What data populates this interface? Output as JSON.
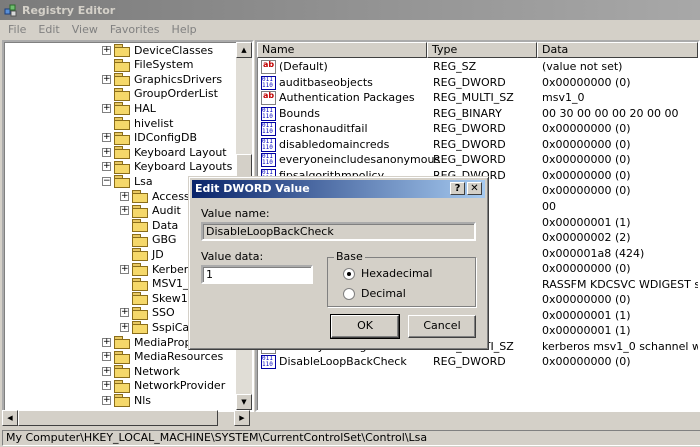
{
  "window": {
    "title": "Registry Editor",
    "icon": "registry-cubes-icon"
  },
  "menu": [
    "File",
    "Edit",
    "View",
    "Favorites",
    "Help"
  ],
  "tree": [
    {
      "label": "DeviceClasses",
      "expandable": true,
      "indent": 0
    },
    {
      "label": "FileSystem",
      "expandable": false,
      "indent": 0
    },
    {
      "label": "GraphicsDrivers",
      "expandable": true,
      "indent": 0
    },
    {
      "label": "GroupOrderList",
      "expandable": false,
      "indent": 0
    },
    {
      "label": "HAL",
      "expandable": true,
      "indent": 0
    },
    {
      "label": "hivelist",
      "expandable": false,
      "indent": 0
    },
    {
      "label": "IDConfigDB",
      "expandable": true,
      "indent": 0
    },
    {
      "label": "Keyboard Layout",
      "expandable": true,
      "indent": 0
    },
    {
      "label": "Keyboard Layouts",
      "expandable": true,
      "indent": 0
    },
    {
      "label": "Lsa",
      "expandable": true,
      "expanded": true,
      "indent": 0
    },
    {
      "label": "AccessPro",
      "expandable": true,
      "indent": 1
    },
    {
      "label": "Audit",
      "expandable": true,
      "indent": 1
    },
    {
      "label": "Data",
      "expandable": false,
      "indent": 1
    },
    {
      "label": "GBG",
      "expandable": false,
      "indent": 1
    },
    {
      "label": "JD",
      "expandable": false,
      "indent": 1
    },
    {
      "label": "Kerberos",
      "expandable": true,
      "indent": 1
    },
    {
      "label": "MSV1_0",
      "expandable": false,
      "indent": 1
    },
    {
      "label": "Skew1",
      "expandable": false,
      "indent": 1
    },
    {
      "label": "SSO",
      "expandable": true,
      "indent": 1
    },
    {
      "label": "SspiCache",
      "expandable": true,
      "indent": 1
    },
    {
      "label": "MediaProperties",
      "expandable": true,
      "indent": 0
    },
    {
      "label": "MediaResources",
      "expandable": true,
      "indent": 0
    },
    {
      "label": "Network",
      "expandable": true,
      "indent": 0
    },
    {
      "label": "NetworkProvider",
      "expandable": true,
      "indent": 0
    },
    {
      "label": "Nls",
      "expandable": true,
      "indent": 0
    }
  ],
  "columns": {
    "name": "Name",
    "type": "Type",
    "data": "Data"
  },
  "values": [
    {
      "icon": "string",
      "name": "(Default)",
      "type": "REG_SZ",
      "data": "(value not set)"
    },
    {
      "icon": "binary",
      "name": "auditbaseobjects",
      "type": "REG_DWORD",
      "data": "0x00000000 (0)"
    },
    {
      "icon": "string",
      "name": "Authentication Packages",
      "type": "REG_MULTI_SZ",
      "data": "msv1_0"
    },
    {
      "icon": "binary",
      "name": "Bounds",
      "type": "REG_BINARY",
      "data": "00 30 00 00 00 20 00 00"
    },
    {
      "icon": "binary",
      "name": "crashonauditfail",
      "type": "REG_DWORD",
      "data": "0x00000000 (0)"
    },
    {
      "icon": "binary",
      "name": "disabledomaincreds",
      "type": "REG_DWORD",
      "data": "0x00000000 (0)"
    },
    {
      "icon": "binary",
      "name": "everyoneincludesanonymous",
      "type": "REG_DWORD",
      "data": "0x00000000 (0)"
    },
    {
      "icon": "binary",
      "name": "fipsalgorithmpolicy",
      "type": "REG_DWORD",
      "data": "0x00000000 (0)"
    },
    {
      "icon": "binary",
      "name": "",
      "type": "",
      "data": "0x00000000 (0)"
    },
    {
      "icon": "binary",
      "name": "",
      "type": "",
      "data": "00"
    },
    {
      "icon": "binary",
      "name": "",
      "type": "D",
      "data": "0x00000001 (1)"
    },
    {
      "icon": "binary",
      "name": "",
      "type": "D",
      "data": "0x00000002 (2)"
    },
    {
      "icon": "binary",
      "name": "",
      "type": "D",
      "data": "0x000001a8 (424)"
    },
    {
      "icon": "binary",
      "name": "",
      "type": "D",
      "data": "0x00000000 (0)"
    },
    {
      "icon": "string",
      "name": "",
      "type": "SZ",
      "data": "RASSFM KDCSVC WDIGEST scecli"
    },
    {
      "icon": "binary",
      "name": "",
      "type": "D",
      "data": "0x00000000 (0)"
    },
    {
      "icon": "binary",
      "name": "",
      "type": "D",
      "data": "0x00000001 (1)"
    },
    {
      "icon": "binary",
      "name": "",
      "type": "D",
      "data": "0x00000001 (1)"
    },
    {
      "icon": "string",
      "name": "Security Packages",
      "type": "REG_MULTI_SZ",
      "data": "kerberos msv1_0 schannel wdigest"
    },
    {
      "icon": "binary",
      "name": "DisableLoopBackCheck",
      "type": "REG_DWORD",
      "data": "0x00000000 (0)"
    }
  ],
  "status": "My Computer\\HKEY_LOCAL_MACHINE\\SYSTEM\\CurrentControlSet\\Control\\Lsa",
  "dialog": {
    "title": "Edit DWORD Value",
    "help_label": "?",
    "close_label": "✕",
    "value_name_label": "Value name:",
    "value_name": "DisableLoopBackCheck",
    "value_data_label": "Value data:",
    "value_data": "1",
    "base_label": "Base",
    "hex_label": "Hexadecimal",
    "dec_label": "Decimal",
    "selected_base": "Hexadecimal",
    "ok_label": "OK",
    "cancel_label": "Cancel"
  }
}
